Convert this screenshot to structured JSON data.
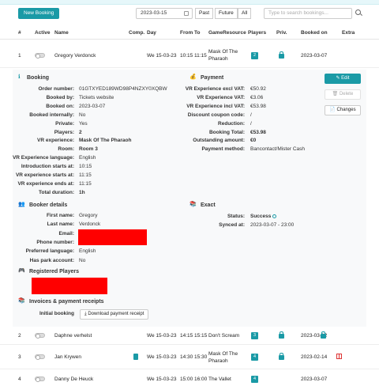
{
  "toolbar": {
    "new_booking": "New Booking",
    "date_value": "2023-03-15",
    "past": "Past",
    "future": "Future",
    "all": "All",
    "search_placeholder": "Type to search bookings..."
  },
  "table": {
    "headers": [
      "#",
      "Active",
      "Name",
      "Comp.",
      "Day",
      "From",
      "To",
      "GameResource",
      "Players",
      "Priv.",
      "Booked on",
      "Extra"
    ],
    "rows": [
      {
        "num": "1",
        "name": "Gregory Verdonck",
        "day": "We 15-03-23",
        "from": "10:15",
        "to": "11:15",
        "game": "Mask Of The Pharaoh",
        "players": "2",
        "booked_on": "2023-03-07"
      },
      {
        "num": "2",
        "name": "Daphne verhelst",
        "day": "We 15-03-23",
        "from": "14:15",
        "to": "15:15",
        "game": "Don't Scream",
        "players": "3",
        "booked_on": "2023-03-12"
      },
      {
        "num": "3",
        "name": "Jan Krywen",
        "day": "We 15-03-23",
        "from": "14:30",
        "to": "15:30",
        "game": "Mask Of The Pharaoh",
        "players": "4",
        "booked_on": "2023-02-14"
      },
      {
        "num": "4",
        "name": "Danny De Heuck",
        "day": "We 15-03-23",
        "from": "15:00",
        "to": "16:00",
        "game": "The Vallet",
        "players": "4",
        "booked_on": "2023-03-07"
      }
    ]
  },
  "booking": {
    "title": "Booking",
    "fields": [
      {
        "label": "Order number:",
        "value": "01GTXYED189WD98P4NZXY0XQBW",
        "bold": false
      },
      {
        "label": "Booked by:",
        "value": "Tickets website",
        "bold": false
      },
      {
        "label": "Booked on:",
        "value": "2023-03-07",
        "bold": false
      },
      {
        "label": "Booked internally:",
        "value": "No",
        "bold": false
      },
      {
        "label": "Private:",
        "value": "Yes",
        "bold": false
      },
      {
        "label": "Players:",
        "value": "2",
        "bold": true
      },
      {
        "label": "VR experience:",
        "value": "Mask Of The Pharaoh",
        "bold": true
      },
      {
        "label": "Room:",
        "value": "Room 3",
        "bold": true
      },
      {
        "label": "VR Experience language:",
        "value": "English",
        "bold": false
      },
      {
        "label": "Introduction starts at:",
        "value": "10:15",
        "bold": false
      },
      {
        "label": "VR experience starts at:",
        "value": "11:15",
        "bold": false
      },
      {
        "label": "VR experience ends at:",
        "value": "11:15",
        "bold": false
      },
      {
        "label": "Total duration:",
        "value": "1h",
        "bold": true
      }
    ]
  },
  "payment": {
    "title": "Payment",
    "fields": [
      {
        "label": "VR Experience excl VAT:",
        "value": "€50.92",
        "bold": false
      },
      {
        "label": "VR Experience VAT:",
        "value": "€3.06",
        "bold": false
      },
      {
        "label": "VR Experience incl VAT:",
        "value": "€53.98",
        "bold": false
      },
      {
        "label": "Discount coupon code:",
        "value": "/",
        "bold": false
      },
      {
        "label": "Reduction:",
        "value": "/",
        "bold": false
      },
      {
        "label": "Booking Total:",
        "value": "€53.98",
        "bold": true
      },
      {
        "label": "Outstanding amount:",
        "value": "€0",
        "bold": true
      },
      {
        "label": "Payment method:",
        "value": "Bancontact/Mister Cash",
        "bold": false
      }
    ]
  },
  "actions": {
    "edit": "Edit",
    "delete": "Delete",
    "changes": "Changes"
  },
  "booker": {
    "title": "Booker details",
    "fields": [
      {
        "label": "First name:",
        "value": "Gregory"
      },
      {
        "label": "Last name:",
        "value": "Verdonck"
      },
      {
        "label": "Email:",
        "value": ""
      },
      {
        "label": "Phone number:",
        "value": ""
      },
      {
        "label": "Preferred language:",
        "value": "English"
      },
      {
        "label": "Has park account:",
        "value": "No"
      }
    ]
  },
  "exact": {
    "title": "Exact",
    "status_label": "Status:",
    "status_value": "Success",
    "synced_label": "Synced at:",
    "synced_value": "2023-03-07 - 23:00"
  },
  "registered": {
    "title": "Registered Players"
  },
  "invoices": {
    "title": "Invoices & payment receipts",
    "initial_label": "Initial booking",
    "download": "Download payment receipt"
  },
  "colors": {
    "accent": "#1a9aa6",
    "redaction": "#ff0000",
    "gift": "#dd3333"
  }
}
